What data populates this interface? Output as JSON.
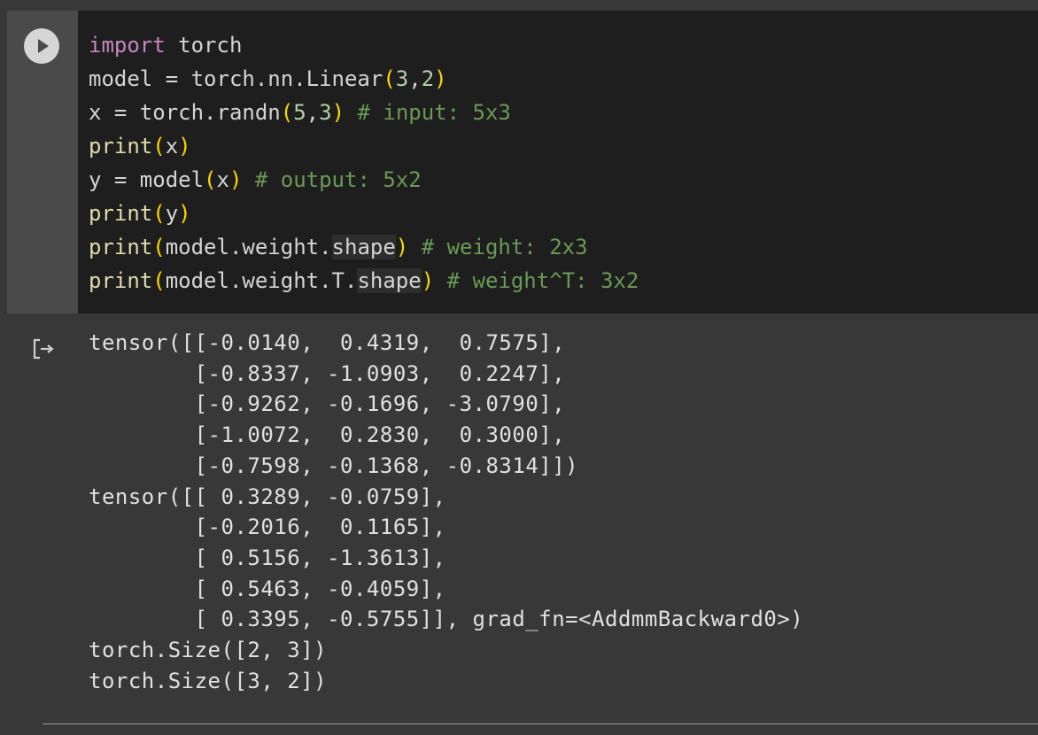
{
  "cell": {
    "code_lines": [
      [
        {
          "t": "import",
          "c": "kw"
        },
        {
          "t": " torch"
        }
      ],
      [
        {
          "t": "model = torch.nn.Linear"
        },
        {
          "t": "(",
          "c": "br"
        },
        {
          "t": "3",
          "c": "num"
        },
        {
          "t": ","
        },
        {
          "t": "2",
          "c": "num"
        },
        {
          "t": ")",
          "c": "br"
        }
      ],
      [
        {
          "t": "x = torch.randn"
        },
        {
          "t": "(",
          "c": "br"
        },
        {
          "t": "5",
          "c": "num"
        },
        {
          "t": ","
        },
        {
          "t": "3",
          "c": "num"
        },
        {
          "t": ")",
          "c": "br"
        },
        {
          "t": " # input: 5x3",
          "c": "cm"
        }
      ],
      [
        {
          "t": "print",
          "c": "fn"
        },
        {
          "t": "(",
          "c": "br"
        },
        {
          "t": "x"
        },
        {
          "t": ")",
          "c": "br"
        }
      ],
      [
        {
          "t": "y = model"
        },
        {
          "t": "(",
          "c": "br"
        },
        {
          "t": "x"
        },
        {
          "t": ")",
          "c": "br"
        },
        {
          "t": " # output: 5x2",
          "c": "cm"
        }
      ],
      [
        {
          "t": "print",
          "c": "fn"
        },
        {
          "t": "(",
          "c": "br"
        },
        {
          "t": "y"
        },
        {
          "t": ")",
          "c": "br"
        }
      ],
      [
        {
          "t": "print",
          "c": "fn"
        },
        {
          "t": "(",
          "c": "br"
        },
        {
          "t": "model.weight."
        },
        {
          "t": "shape",
          "c": "hl"
        },
        {
          "t": ")",
          "c": "br"
        },
        {
          "t": " # weight: 2x3",
          "c": "cm"
        }
      ],
      [
        {
          "t": "print",
          "c": "fn"
        },
        {
          "t": "(",
          "c": "br"
        },
        {
          "t": "model.weight.T."
        },
        {
          "t": "shape",
          "c": "hl"
        },
        {
          "t": ")",
          "c": "br"
        },
        {
          "t": " # weight^T: 3x2",
          "c": "cm"
        }
      ]
    ]
  },
  "output": {
    "text": "tensor([[-0.0140,  0.4319,  0.7575],\n        [-0.8337, -1.0903,  0.2247],\n        [-0.9262, -0.1696, -3.0790],\n        [-1.0072,  0.2830,  0.3000],\n        [-0.7598, -0.1368, -0.8314]])\ntensor([[ 0.3289, -0.0759],\n        [-0.2016,  0.1165],\n        [ 0.5156, -1.3613],\n        [ 0.5463, -0.4059],\n        [ 0.3395, -0.5755]], grad_fn=<AddmmBackward0>)\ntorch.Size([2, 3])\ntorch.Size([3, 2])"
  },
  "icons": {
    "run": "play-icon",
    "output": "output-arrow-icon"
  }
}
